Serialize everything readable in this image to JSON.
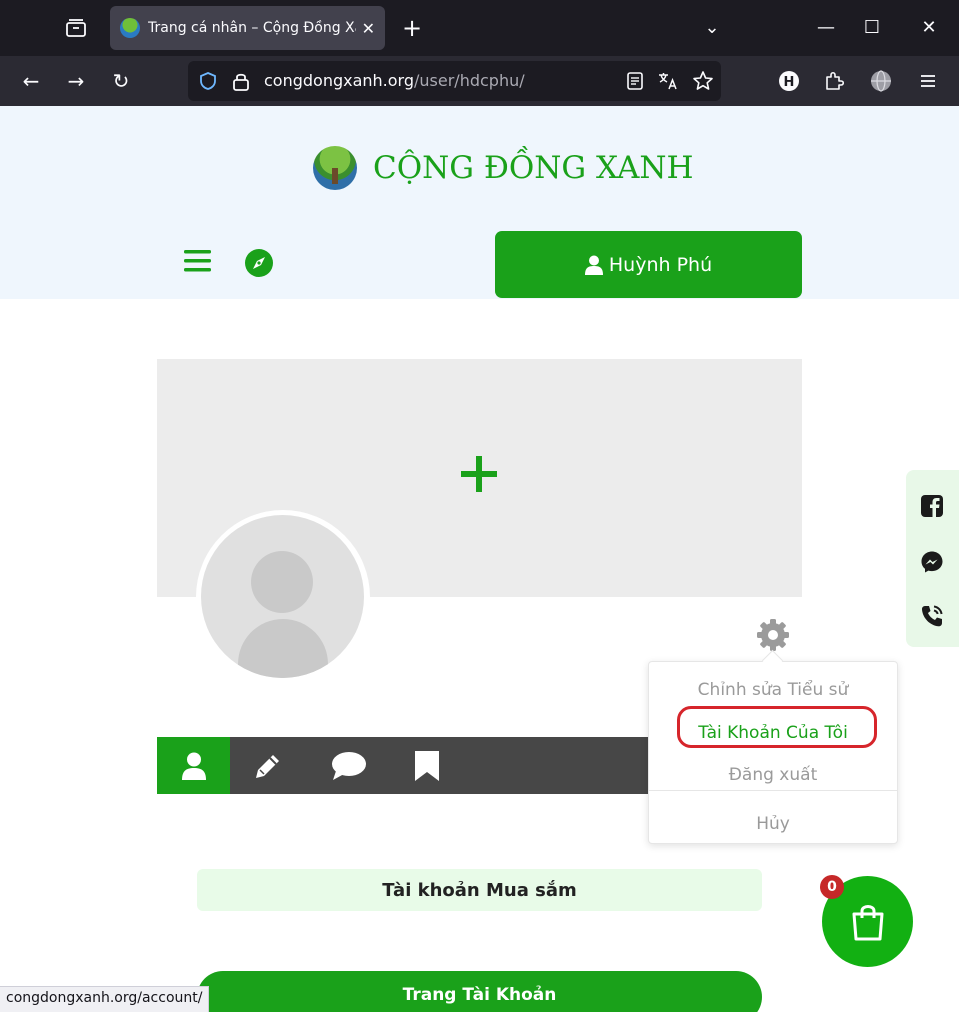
{
  "browser": {
    "tab_title": "Trang cá nhân – Cộng Đồng Xanh",
    "tab_close_glyph": "✕",
    "new_tab_glyph": "+",
    "url_domain": "congdongxanh.org",
    "url_path": "/user/hdcphu/",
    "profile_initial": "H",
    "window_controls": {
      "dropdown": "⌄",
      "minimize": "—",
      "maximize": "☐",
      "close": "✕"
    },
    "nav": {
      "back": "←",
      "forward": "→",
      "reload": "↻"
    }
  },
  "site": {
    "logo_text": "CỘNG ĐỒNG XANH",
    "user_button_label": "Huỳnh Phú",
    "brand_green": "#1aa11a"
  },
  "profile": {
    "tabs": [
      {
        "icon": "user-icon",
        "active": true
      },
      {
        "icon": "pencil-icon",
        "active": false
      },
      {
        "icon": "comment-icon",
        "active": false
      },
      {
        "icon": "bookmark-icon",
        "active": false
      }
    ]
  },
  "dropdown": {
    "edit_bio": "Chỉnh sửa Tiểu sử",
    "my_account": "Tài Khoản Của Tôi",
    "logout": "Đăng xuất",
    "cancel": "Hủy"
  },
  "content": {
    "shopping_account": "Tài khoản Mua sắm",
    "account_page_button": "Trang Tài Khoản"
  },
  "cart": {
    "count": "0"
  },
  "status_bar": {
    "link_url": "congdongxanh.org/account/"
  }
}
